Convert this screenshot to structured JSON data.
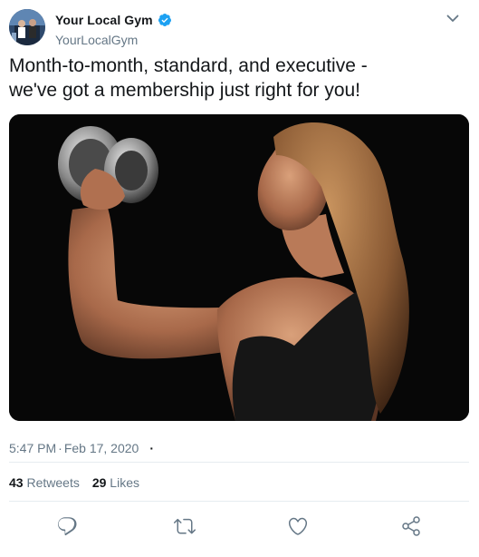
{
  "author": {
    "display_name": "Your Local Gym",
    "handle": "YourLocalGym",
    "verified": true,
    "avatar_icon": "avatar-gym-logo",
    "verified_icon": "verified-badge-icon"
  },
  "tweet": {
    "text_line1": "Month-to-month, standard, and executive -",
    "text_line2": "we've got a membership just right for you!",
    "image_alt": "photo-woman-lifting-dumbbell"
  },
  "meta": {
    "time": "5:47 PM",
    "date": "Feb 17, 2020",
    "separator": "·",
    "trailing": "·"
  },
  "stats": {
    "retweets_count": "43",
    "retweets_label": "Retweets",
    "likes_count": "29",
    "likes_label": "Likes"
  },
  "actions": {
    "reply_icon": "reply-icon",
    "retweet_icon": "retweet-icon",
    "like_icon": "heart-icon",
    "share_icon": "share-icon"
  },
  "colors": {
    "verified_blue": "#1da1f2",
    "text_primary": "#14171a",
    "text_secondary": "#657786",
    "divider": "#e6ecf0"
  }
}
